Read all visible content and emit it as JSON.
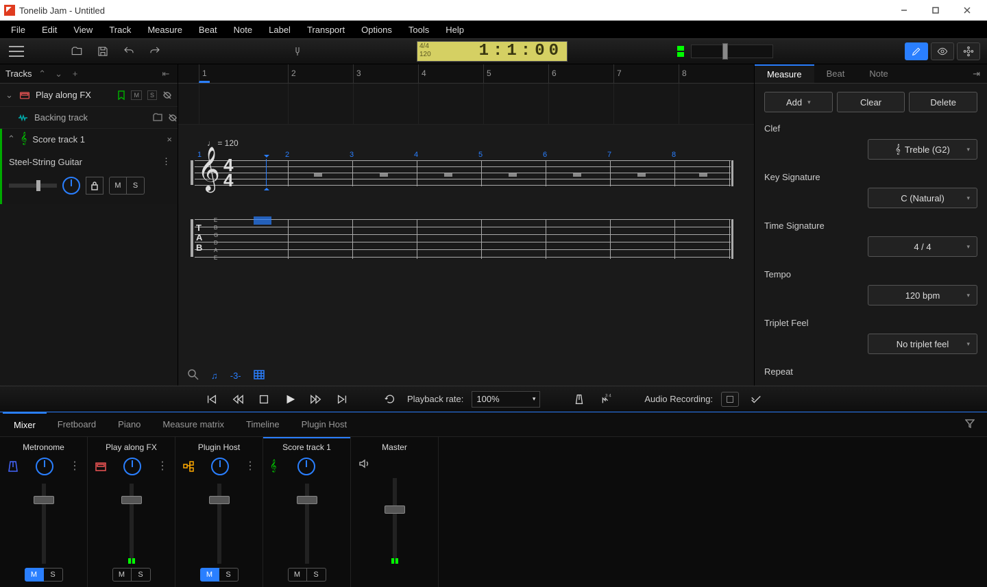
{
  "title": "Tonelib Jam - Untitled",
  "menu": [
    "File",
    "Edit",
    "View",
    "Track",
    "Measure",
    "Beat",
    "Note",
    "Label",
    "Transport",
    "Options",
    "Tools",
    "Help"
  ],
  "lcd": {
    "top": "4/4",
    "bottom": "120",
    "display": "1:1:00"
  },
  "tracksHeader": "Tracks",
  "tracks": {
    "playalong": "Play along FX",
    "backing": "Backing track",
    "score": "Score track 1",
    "instrument": "Steel-String Guitar"
  },
  "ruler": [
    "1",
    "2",
    "3",
    "4",
    "5",
    "6",
    "7",
    "8"
  ],
  "tempoMark": "= 120",
  "tabStrings": [
    "E",
    "B",
    "G",
    "D",
    "A",
    "E"
  ],
  "rightTabs": [
    "Measure",
    "Beat",
    "Note"
  ],
  "buttons": {
    "add": "Add",
    "clear": "Clear",
    "delete": "Delete"
  },
  "props": {
    "clef": {
      "label": "Clef",
      "value": "Treble (G2)"
    },
    "key": {
      "label": "Key Signature",
      "value": "C (Natural)"
    },
    "time": {
      "label": "Time Signature",
      "value": "4 / 4"
    },
    "tempo": {
      "label": "Tempo",
      "value": "120 bpm"
    },
    "triplet": {
      "label": "Triplet Feel",
      "value": "No triplet feel"
    },
    "repeat": {
      "label": "Repeat"
    }
  },
  "transport": {
    "playbackRateLabel": "Playback rate:",
    "playbackRate": "100%",
    "audioRecording": "Audio Recording:"
  },
  "bottomTabs": [
    "Mixer",
    "Fretboard",
    "Piano",
    "Measure matrix",
    "Timeline",
    "Plugin Host"
  ],
  "mixer": {
    "channels": [
      {
        "name": "Metronome",
        "muted": true
      },
      {
        "name": "Play along FX",
        "muted": false
      },
      {
        "name": "Plugin Host",
        "muted": true
      },
      {
        "name": "Score track 1",
        "muted": false,
        "selected": true
      },
      {
        "name": "Master"
      }
    ],
    "m": "M",
    "s": "S"
  },
  "tabWord": "T\nA\nB",
  "timesig": {
    "top": "4",
    "bot": "4"
  }
}
